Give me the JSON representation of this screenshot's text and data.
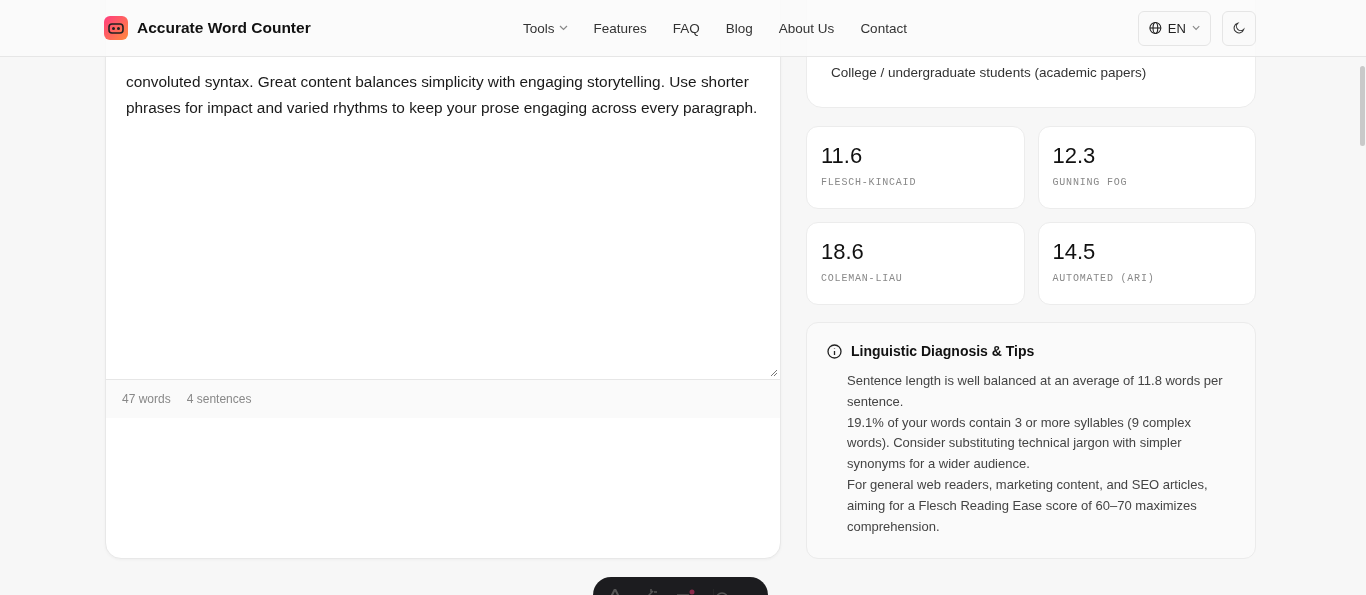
{
  "header": {
    "brand": "Accurate Word Counter",
    "nav": [
      {
        "label": "Tools",
        "has_menu": true
      },
      {
        "label": "Features",
        "has_menu": false
      },
      {
        "label": "FAQ",
        "has_menu": false
      },
      {
        "label": "Blog",
        "has_menu": false
      },
      {
        "label": "About Us",
        "has_menu": false
      },
      {
        "label": "Contact",
        "has_menu": false
      }
    ],
    "language": "EN"
  },
  "editor": {
    "text": "convoluted syntax. Great content balances simplicity with engaging storytelling. Use shorter phrases for impact and varied rhythms to keep your prose engaging across every paragraph.",
    "stats": [
      "47 words",
      "4 sentences"
    ]
  },
  "audience": {
    "text": "College / undergraduate students (academic papers)"
  },
  "scores": [
    {
      "value": "11.6",
      "label": "FLESCH-KINCAID"
    },
    {
      "value": "12.3",
      "label": "GUNNING FOG"
    },
    {
      "value": "18.6",
      "label": "COLEMAN-LIAU"
    },
    {
      "value": "14.5",
      "label": "AUTOMATED (ARI)"
    }
  ],
  "tips": {
    "title": "Linguistic Diagnosis & Tips",
    "items": [
      "Sentence length is well balanced at an average of 11.8 words per sentence.",
      "19.1% of your words contain 3 or more syllables (9 complex words). Consider substituting technical jargon with simpler synonyms for a wider audience.",
      "For general web readers, marketing content, and SEO articles, aiming for a Flesch Reading Ease score of 60–70 maximizes comprehension."
    ]
  }
}
